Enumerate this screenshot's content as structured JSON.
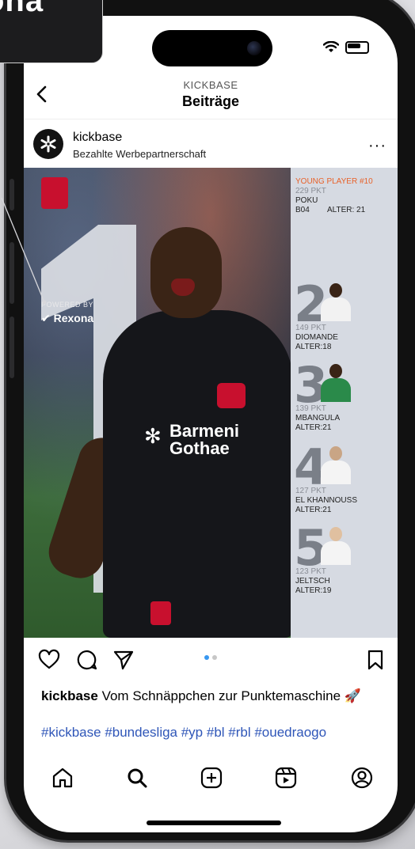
{
  "overlay_tag": "ona",
  "header": {
    "subtitle": "KICKBASE",
    "title": "Beiträge"
  },
  "post": {
    "username": "kickbase",
    "partner_label": "Bezahlte Werbepartnerschaft",
    "more": "···"
  },
  "image": {
    "powered_by": "POWERED BY",
    "sponsor_brand": "✔ Rexona",
    "jersey_sponsor_line1": "Barmeni",
    "jersey_sponsor_line2": "Gothae",
    "jersey_logo": "✻",
    "panel": {
      "title": "YOUNG PLAYER #10",
      "leader": {
        "points": "229 PKT",
        "name": "POKU",
        "club": "B04",
        "age": "ALTER: 21"
      },
      "ranks": [
        {
          "rank": "2",
          "points": "149 PKT",
          "name": "DIOMANDE",
          "age": "ALTER:18"
        },
        {
          "rank": "3",
          "points": "139 PKT",
          "name": "MBANGULA",
          "age": "ALTER:21"
        },
        {
          "rank": "4",
          "points": "127 PKT",
          "name": "EL KHANNOUSS",
          "age": "ALTER:21"
        },
        {
          "rank": "5",
          "points": "123 PKT",
          "name": "JELTSCH",
          "age": "ALTER:19"
        }
      ]
    }
  },
  "caption": {
    "username": "kickbase",
    "text": "Vom Schnäppchen zur Punktemaschine 🚀",
    "hashtags": "#kickbase #bundesliga #yp #bl #rbl #ouedraogo"
  },
  "icons": {
    "like": "heart-icon",
    "comment": "comment-icon",
    "share": "send-icon",
    "save": "bookmark-icon",
    "tabs": [
      "home-icon",
      "search-icon",
      "create-icon",
      "reels-icon",
      "profile-icon"
    ]
  },
  "colors": {
    "hashtag": "#2f56b8",
    "carousel_active": "#3897f0",
    "panel_accent": "#e8622a",
    "club_red": "#c8102e"
  }
}
